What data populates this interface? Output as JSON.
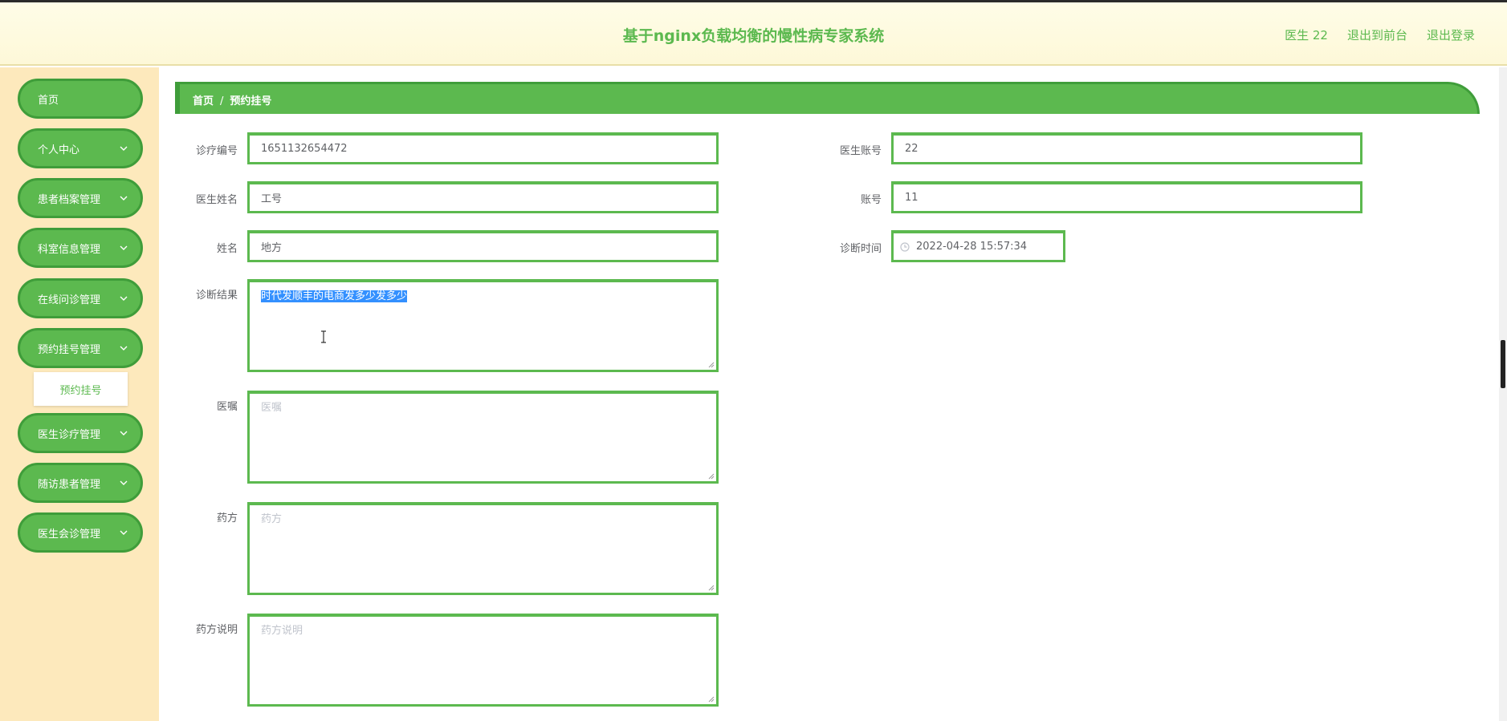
{
  "header": {
    "title": "基于nginx负载均衡的慢性病专家系统",
    "links": [
      "医生 22",
      "退出到前台",
      "退出登录"
    ]
  },
  "sidebar": {
    "items": [
      {
        "label": "首页",
        "has_chevron": false
      },
      {
        "label": "个人中心",
        "has_chevron": true
      },
      {
        "label": "患者档案管理",
        "has_chevron": true
      },
      {
        "label": "科室信息管理",
        "has_chevron": true
      },
      {
        "label": "在线问诊管理",
        "has_chevron": true
      },
      {
        "label": "预约挂号管理",
        "has_chevron": true
      },
      {
        "label": "医生诊疗管理",
        "has_chevron": true
      },
      {
        "label": "随访患者管理",
        "has_chevron": true
      },
      {
        "label": "医生会诊管理",
        "has_chevron": true
      }
    ],
    "submenu": {
      "label": "预约挂号"
    }
  },
  "breadcrumb": {
    "home": "首页",
    "separator": "/",
    "current": "预约挂号"
  },
  "form": {
    "treatment_no": {
      "label": "诊疗编号",
      "value": "1651132654472"
    },
    "doctor_account": {
      "label": "医生账号",
      "value": "22"
    },
    "doctor_name": {
      "label": "医生姓名",
      "value": "工号"
    },
    "account": {
      "label": "账号",
      "value": "11"
    },
    "name": {
      "label": "姓名",
      "value": "地方"
    },
    "diagnosis_time": {
      "label": "诊断时间",
      "value": "2022-04-28 15:57:34"
    },
    "diagnosis_result": {
      "label": "诊断结果",
      "value": "时代发顺丰的电商发多少发多少"
    },
    "doctor_advice": {
      "label": "医嘱",
      "placeholder": "医嘱"
    },
    "prescription": {
      "label": "药方",
      "placeholder": "药方"
    },
    "prescription_note": {
      "label": "药方说明",
      "placeholder": "药方说明"
    }
  },
  "colors": {
    "accent": "#5cb94f",
    "accent_dark": "#3f9d3a",
    "sidebar_bg": "#fde9bc"
  }
}
